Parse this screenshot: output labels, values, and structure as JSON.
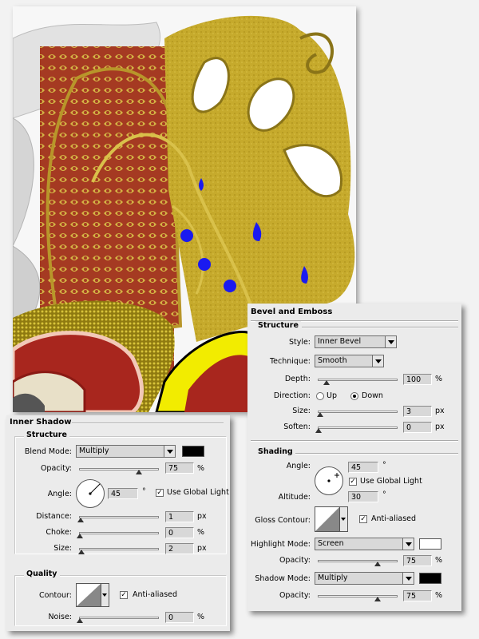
{
  "inner_shadow": {
    "title": "Inner Shadow",
    "structure": {
      "legend": "Structure",
      "blend_mode_label": "Blend Mode:",
      "blend_mode_value": "Multiply",
      "blend_color": "#000000",
      "opacity_label": "Opacity:",
      "opacity_value": "75",
      "opacity_unit": "%",
      "opacity_fraction": 0.75,
      "angle_label": "Angle:",
      "angle_value": "45",
      "angle_unit": "°",
      "global_light_label": "Use Global Light",
      "global_light_checked": true,
      "distance_label": "Distance:",
      "distance_value": "1",
      "distance_unit": "px",
      "choke_label": "Choke:",
      "choke_value": "0",
      "choke_unit": "%",
      "size_label": "Size:",
      "size_value": "2",
      "size_unit": "px"
    },
    "quality": {
      "legend": "Quality",
      "contour_label": "Contour:",
      "anti_aliased_label": "Anti-aliased",
      "anti_aliased_checked": true,
      "noise_label": "Noise:",
      "noise_value": "0",
      "noise_unit": "%"
    }
  },
  "bevel_emboss": {
    "title": "Bevel and Emboss",
    "structure": {
      "legend": "Structure",
      "style_label": "Style:",
      "style_value": "Inner Bevel",
      "technique_label": "Technique:",
      "technique_value": "Smooth",
      "depth_label": "Depth:",
      "depth_value": "100",
      "depth_unit": "%",
      "direction_label": "Direction:",
      "direction_up_label": "Up",
      "direction_down_label": "Down",
      "direction_selected": "Down",
      "size_label": "Size:",
      "size_value": "3",
      "size_unit": "px",
      "soften_label": "Soften:",
      "soften_value": "0",
      "soften_unit": "px"
    },
    "shading": {
      "legend": "Shading",
      "angle_label": "Angle:",
      "angle_value": "45",
      "angle_unit": "°",
      "global_light_label": "Use Global Light",
      "global_light_checked": true,
      "altitude_label": "Altitude:",
      "altitude_value": "30",
      "altitude_unit": "°",
      "gloss_contour_label": "Gloss Contour:",
      "anti_aliased_label": "Anti-aliased",
      "anti_aliased_checked": true,
      "highlight_mode_label": "Highlight Mode:",
      "highlight_mode_value": "Screen",
      "highlight_color": "#ffffff",
      "highlight_opacity_label": "Opacity:",
      "highlight_opacity_value": "75",
      "highlight_opacity_unit": "%",
      "shadow_mode_label": "Shadow Mode:",
      "shadow_mode_value": "Multiply",
      "shadow_color": "#000000",
      "shadow_opacity_label": "Opacity:",
      "shadow_opacity_value": "75",
      "shadow_opacity_unit": "%"
    }
  },
  "colors": {
    "artwork_gold": "#c9ad2e",
    "artwork_red": "#a8261e",
    "artwork_blue_drops": "#1a1af0",
    "artwork_yellow": "#f2ec00"
  }
}
